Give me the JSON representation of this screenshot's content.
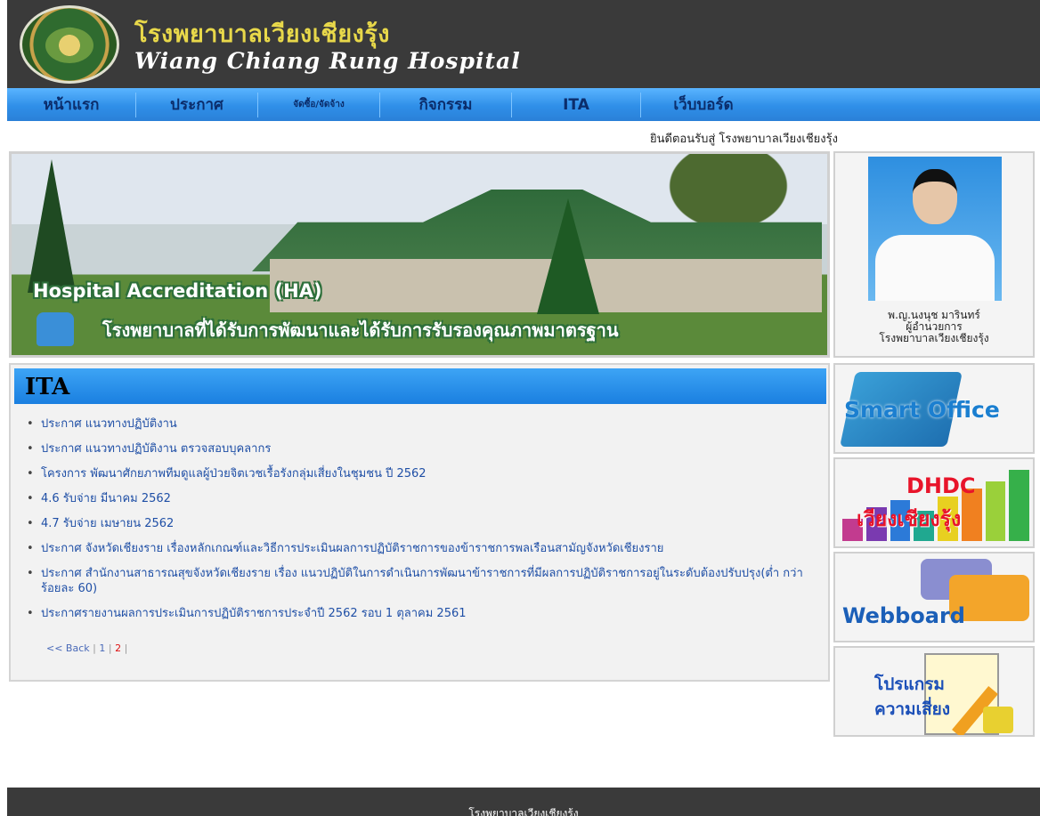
{
  "header": {
    "title_th": "โรงพยาบาลเวียงเชียงรุ้ง",
    "title_en": "Wiang Chiang Rung Hospital",
    "logo": "hospital-seal-logo"
  },
  "nav": {
    "items": [
      {
        "label": "หน้าแรก"
      },
      {
        "label": "ประกาศ"
      },
      {
        "label": "จัดซื้อ/จัดจ้าง"
      },
      {
        "label": "กิจกรรม"
      },
      {
        "label": "ITA"
      },
      {
        "label": "เว็บบอร์ด"
      }
    ]
  },
  "welcome": "ยินดีตอนรับสู่ โรงพยาบาลเวียงเชียงรุ้ง",
  "banner": {
    "accreditation": "Hospital Accreditation (HA)",
    "slogan": "โรงพยาบาลที่ได้รับการพัฒนาและได้รับการรับรองคุณภาพมาตรฐาน"
  },
  "director": {
    "name": "พ.ญ.นงนุช มารินทร์",
    "position": "ผู้อำนวยการ",
    "org": "โรงพยาบาลเวียงเชียงรุ้ง"
  },
  "ita": {
    "title": "ITA",
    "items": [
      "ประกาศ แนวทางปฏิบัติงาน",
      "ประกาศ แนวทางปฏิบัติงาน ตรวจสอบบุคลากร",
      "โครงการ พัฒนาศักยภาพทีมดูแลผู้ป่วยจิตเวชเรื้อรังกลุ่มเสี่ยงในชุมชน ปี 2562",
      "4.6 รับจ่าย มีนาคม 2562",
      "4.7 รับจ่าย เมษายน 2562",
      "ประกาศ จังหวัดเชียงราย เรื่องหลักเกณฑ์และวิธีการประเมินผลการปฏิบัติราชการของข้าราชการพลเรือนสามัญจังหวัดเชียงราย",
      "ประกาศ สำนักงานสาธารณสุขจังหวัดเชียงราย เรื่อง แนวปฏิบัติในการดำเนินการพัฒนาข้าราชการที่มีผลการปฏิบัติราชการอยู่ในระดับต้องปรับปรุง(ต่ำ กว่าร้อยละ 60)",
      "ประกาศรายงานผลการประเมินการปฏิบัติราชการประจำปี 2562 รอบ 1 ตุลาคม 2561"
    ],
    "pager": {
      "back": "<< Back",
      "page1": "1",
      "page2": "2"
    }
  },
  "widgets": {
    "smart_office": "Smart Office",
    "dhdc_top": "DHDC",
    "dhdc_bottom": "เวียงเชียงรุ้ง",
    "webboard": "Webboard",
    "risk_line1": "โปรแกรม",
    "risk_line2": "ความเสี่ยง"
  },
  "footer": {
    "text": "โรงพยาบาลเวียงเชียงรุ้ง"
  },
  "colors": {
    "nav": "#2f8fe8",
    "header": "#3a3a3a",
    "link": "#1f4fa6",
    "title_th": "#e8d84a"
  }
}
